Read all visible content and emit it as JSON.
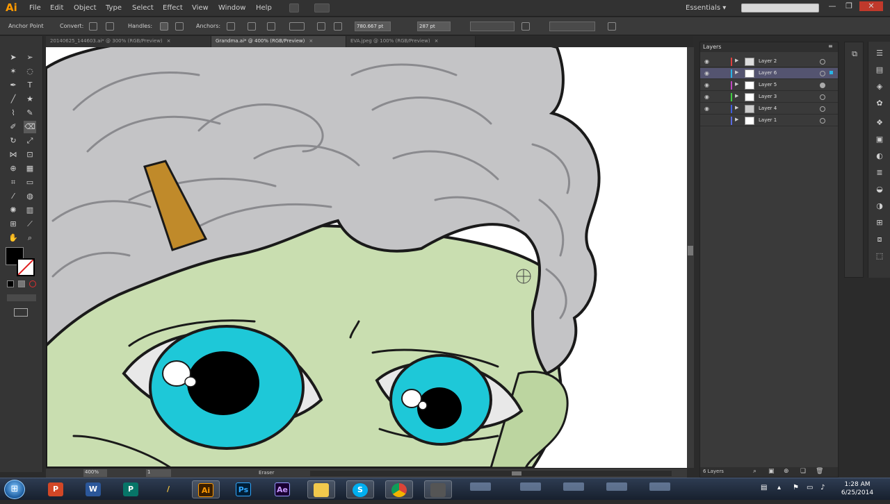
{
  "app": {
    "logo": "Ai"
  },
  "menu": [
    "File",
    "Edit",
    "Object",
    "Type",
    "Select",
    "Effect",
    "View",
    "Window",
    "Help"
  ],
  "workspace": {
    "label": "Essentials",
    "arrow": "▾"
  },
  "window_buttons": {
    "minimize": "—",
    "maximize": "❐",
    "close": "✕"
  },
  "control": {
    "anchor_point_label": "Anchor Point",
    "convert_label": "Convert:",
    "handles_label": "Handles:",
    "anchors_label": "Anchors:",
    "x_value": "780.667 pt",
    "y_value": "287 pt"
  },
  "tabs": [
    {
      "label": "20140625_144603.ai* @ 300% (RGB/Preview)",
      "close": "×"
    },
    {
      "label": "Grandma.ai* @ 400% (RGB/Preview)",
      "close": "×"
    },
    {
      "label": "EVA.jpeg @ 100% (RGB/Preview)",
      "close": "×"
    }
  ],
  "status": {
    "zoom": "400%",
    "page": "1",
    "tool": "Eraser"
  },
  "layers_panel": {
    "title": "Layers",
    "count": "6 Layers",
    "layers": [
      {
        "name": "Layer 2",
        "color": "#e0403e",
        "visible": true,
        "active": false
      },
      {
        "name": "Layer 6",
        "color": "#28b4e6",
        "visible": true,
        "active": true
      },
      {
        "name": "Layer 5",
        "color": "#c047c0",
        "visible": true,
        "active": false
      },
      {
        "name": "Layer 3",
        "color": "#3fcf3f",
        "visible": true,
        "active": false
      },
      {
        "name": "Layer 4",
        "color": "#3f5fe0",
        "visible": true,
        "active": false
      },
      {
        "name": "Layer 1",
        "color": "#5a6ae0",
        "visible": false,
        "active": false
      }
    ]
  },
  "taskbar": {
    "apps": [
      "P",
      "W",
      "P",
      "/",
      "Ai",
      "Ps",
      "Ae",
      "",
      "S",
      "",
      ""
    ],
    "clock_time": "1:28 AM",
    "clock_date": "6/25/2014"
  },
  "colors": {
    "hair": "#c4c4c6",
    "skin": "#c9deb0",
    "iris": "#1ec8d8",
    "clip": "#c08a2a",
    "outline": "#1a1a1a"
  }
}
